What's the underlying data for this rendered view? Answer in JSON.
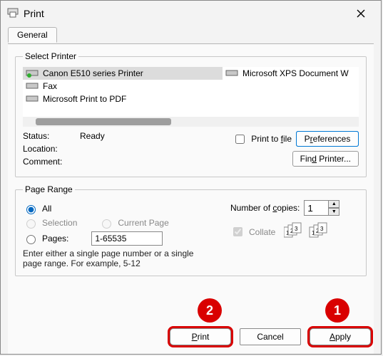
{
  "window": {
    "title": "Print"
  },
  "tabs": {
    "general": "General"
  },
  "printerGroup": {
    "legend": "Select Printer",
    "items": [
      {
        "name": "Canon E510 series Printer",
        "selected": true,
        "default": true
      },
      {
        "name": "Fax",
        "selected": false,
        "default": false
      },
      {
        "name": "Microsoft Print to PDF",
        "selected": false,
        "default": false
      },
      {
        "name": "Microsoft XPS Document W",
        "selected": false,
        "default": false
      }
    ]
  },
  "status": {
    "statusLabel": "Status:",
    "statusValue": "Ready",
    "locationLabel": "Location:",
    "locationValue": "",
    "commentLabel": "Comment:",
    "commentValue": "",
    "printToFile": "Print to file",
    "preferences": "Preferences",
    "findPrinter": "Find Printer..."
  },
  "pageRange": {
    "legend": "Page Range",
    "all": "All",
    "selection": "Selection",
    "currentPage": "Current Page",
    "pages": "Pages:",
    "pagesValue": "1-65535",
    "help": "Enter either a single page number or a single page range.  For example, 5-12",
    "copiesLabel": "Number of copies:",
    "copiesValue": "1",
    "collate": "Collate"
  },
  "actions": {
    "print": "Print",
    "cancel": "Cancel",
    "apply": "Apply"
  },
  "annotations": {
    "badge1": "1",
    "badge2": "2"
  }
}
